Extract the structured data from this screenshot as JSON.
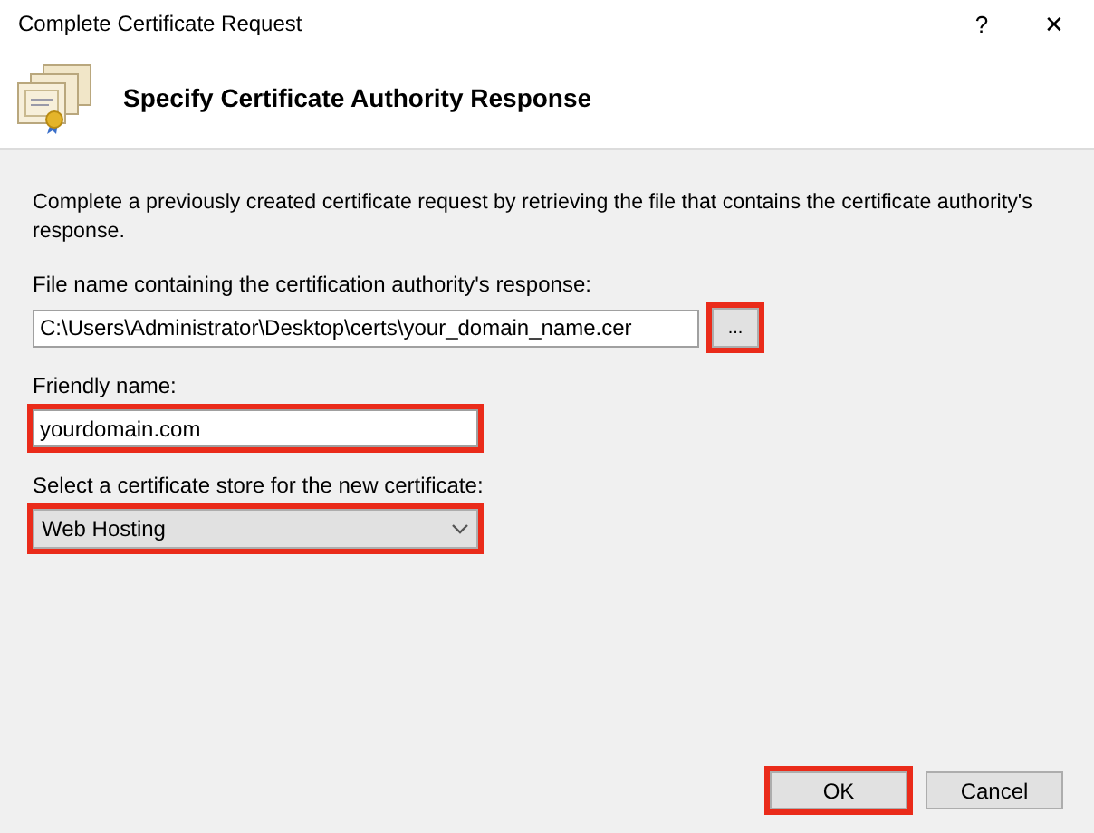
{
  "window": {
    "title": "Complete Certificate Request",
    "help_button": "?",
    "close_button": "✕"
  },
  "header": {
    "title": "Specify Certificate Authority Response"
  },
  "description": "Complete a previously created certificate request by retrieving the file that contains the certificate authority's response.",
  "file_field": {
    "label": "File name containing the certification authority's response:",
    "value": "C:\\Users\\Administrator\\Desktop\\certs\\your_domain_name.cer",
    "highlighted": false
  },
  "browse_button": {
    "label": "...",
    "highlighted": true
  },
  "friendly_name": {
    "label": "Friendly name:",
    "value": "yourdomain.com",
    "highlighted": true
  },
  "store": {
    "label": "Select a certificate store for the new certificate:",
    "value": "Web Hosting",
    "highlighted": true
  },
  "buttons": [
    {
      "label": "OK",
      "highlighted": true
    },
    {
      "label": "Cancel",
      "highlighted": false
    }
  ]
}
